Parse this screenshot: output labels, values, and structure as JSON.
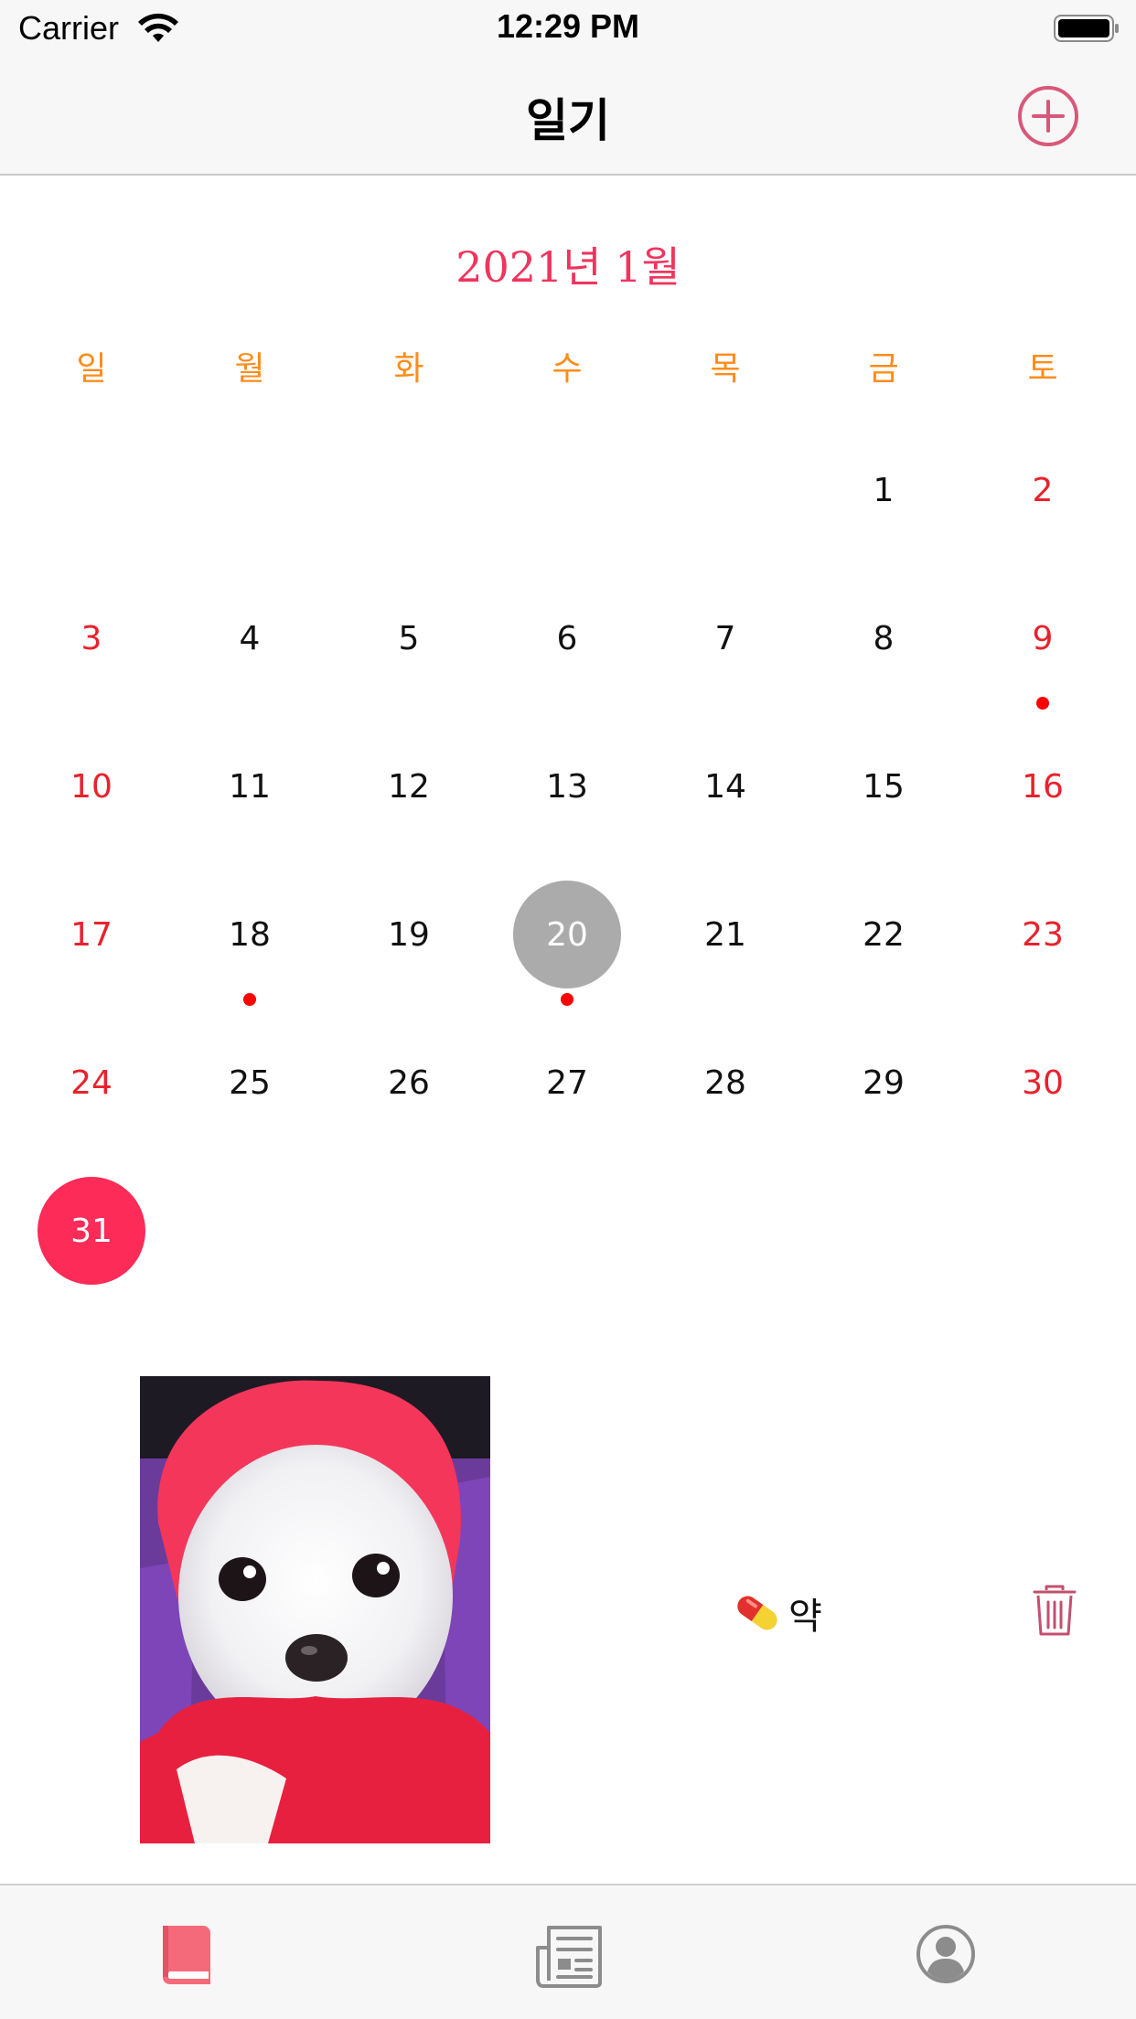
{
  "status_bar": {
    "carrier": "Carrier",
    "time": "12:29 PM",
    "icons": [
      "wifi-icon",
      "battery-icon"
    ]
  },
  "nav": {
    "title": "일기",
    "add_icon": "plus-circle-icon"
  },
  "calendar": {
    "month_title": "2021년 1월",
    "weekdays": [
      "일",
      "월",
      "화",
      "수",
      "목",
      "금",
      "토"
    ],
    "first_weekday_index": 5,
    "days_in_month": 31,
    "selected_day": 20,
    "today": 31,
    "event_days": [
      9,
      18,
      20
    ],
    "colors": {
      "accent": "#f0345e",
      "weekday_header": "#ff8c1a",
      "weekend": "#e8222c",
      "selected": "#ababab",
      "today": "#fc2b57",
      "event_dot": "#ff0000"
    }
  },
  "entry": {
    "photo": "dog-photo",
    "label": "약",
    "label_icon": "pill-icon",
    "delete_icon": "trash-icon"
  },
  "tab_bar": {
    "tabs": [
      {
        "icon": "book-icon",
        "active": true
      },
      {
        "icon": "news-icon",
        "active": false
      },
      {
        "icon": "profile-icon",
        "active": false
      }
    ],
    "active_color": "#f56a7a",
    "inactive_color": "#8c8c8c"
  }
}
